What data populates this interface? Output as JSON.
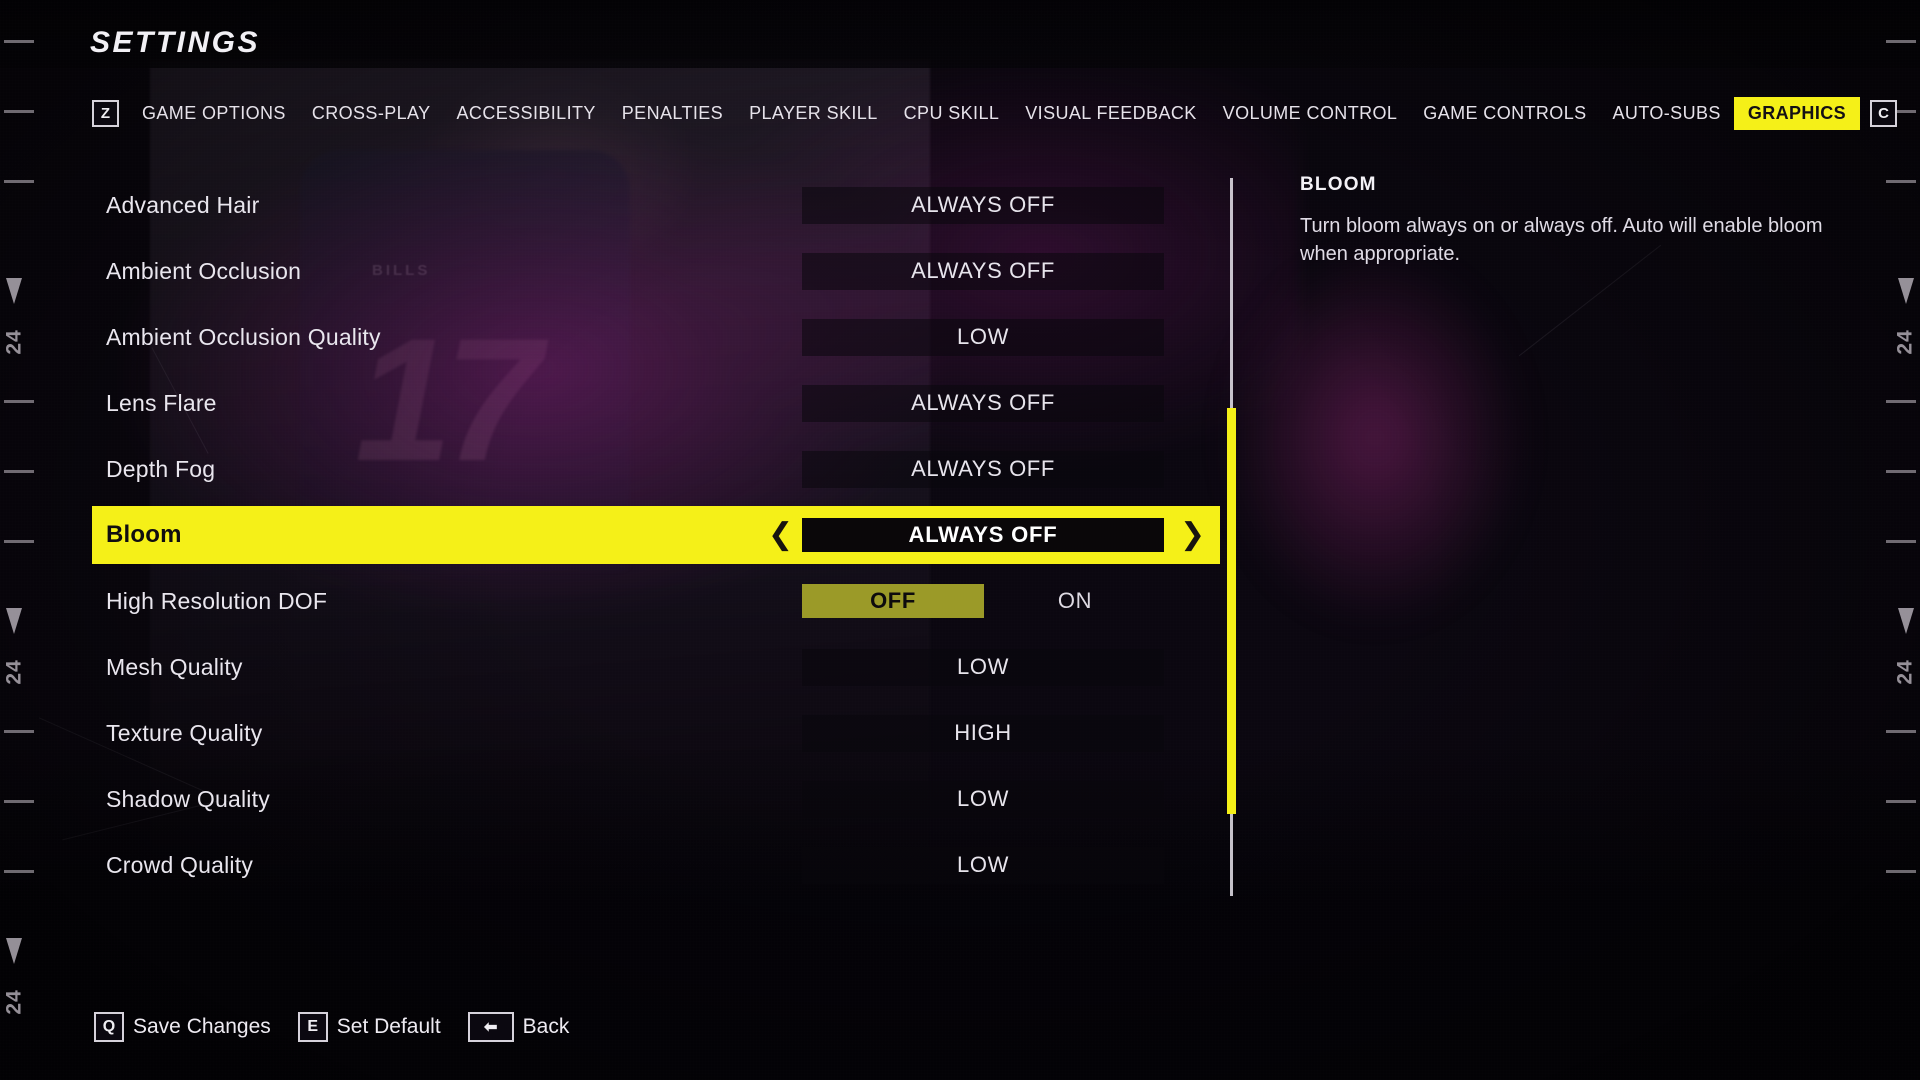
{
  "header": {
    "title": "SETTINGS"
  },
  "tabbar": {
    "prev_key": "Z",
    "next_key": "C",
    "tabs": [
      {
        "label": "GAME OPTIONS",
        "active": false
      },
      {
        "label": "CROSS-PLAY",
        "active": false
      },
      {
        "label": "ACCESSIBILITY",
        "active": false
      },
      {
        "label": "PENALTIES",
        "active": false
      },
      {
        "label": "PLAYER SKILL",
        "active": false
      },
      {
        "label": "CPU SKILL",
        "active": false
      },
      {
        "label": "VISUAL FEEDBACK",
        "active": false
      },
      {
        "label": "VOLUME CONTROL",
        "active": false
      },
      {
        "label": "GAME CONTROLS",
        "active": false
      },
      {
        "label": "AUTO-SUBS",
        "active": false
      },
      {
        "label": "GRAPHICS",
        "active": true
      }
    ]
  },
  "settings": {
    "rows": [
      {
        "label": "Advanced Hair",
        "value": "ALWAYS OFF",
        "type": "cycle",
        "selected": false
      },
      {
        "label": "Ambient Occlusion",
        "value": "ALWAYS OFF",
        "type": "cycle",
        "selected": false
      },
      {
        "label": "Ambient Occlusion Quality",
        "value": "LOW",
        "type": "cycle",
        "selected": false
      },
      {
        "label": "Lens Flare",
        "value": "ALWAYS OFF",
        "type": "cycle",
        "selected": false
      },
      {
        "label": "Depth Fog",
        "value": "ALWAYS OFF",
        "type": "cycle",
        "selected": false
      },
      {
        "label": "Bloom",
        "value": "ALWAYS OFF",
        "type": "cycle",
        "selected": true
      },
      {
        "label": "High Resolution DOF",
        "value": "OFF",
        "type": "toggle",
        "selected": false,
        "options": [
          "OFF",
          "ON"
        ]
      },
      {
        "label": "Mesh Quality",
        "value": "LOW",
        "type": "cycle",
        "selected": false
      },
      {
        "label": "Texture Quality",
        "value": "HIGH",
        "type": "cycle",
        "selected": false
      },
      {
        "label": "Shadow Quality",
        "value": "LOW",
        "type": "cycle",
        "selected": false
      },
      {
        "label": "Crowd Quality",
        "value": "LOW",
        "type": "cycle",
        "selected": false
      }
    ],
    "arrow_left": "❮",
    "arrow_right": "❯"
  },
  "info": {
    "title": "BLOOM",
    "body": "Turn bloom always on or always off. Auto will enable bloom when appropriate."
  },
  "footer": {
    "actions": [
      {
        "key": "Q",
        "label": "Save Changes",
        "wide": false
      },
      {
        "key": "E",
        "label": "Set Default",
        "wide": false
      },
      {
        "key": "⬅",
        "label": "Back",
        "wide": true
      }
    ]
  },
  "rulers": {
    "number": "24"
  },
  "colors": {
    "accent": "#f5f018",
    "accent_dim": "#9b9a28",
    "background": "#0a0610",
    "text": "#e9e6ee"
  },
  "background_art": {
    "jersey_number": "17",
    "jersey_team": "BILLS"
  }
}
